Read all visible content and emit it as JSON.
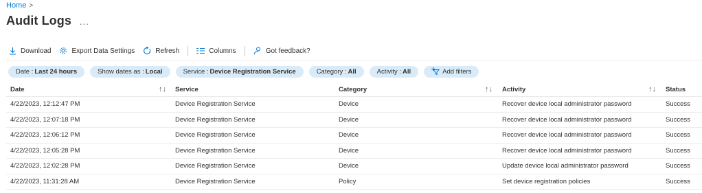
{
  "breadcrumb": {
    "home": "Home",
    "separator": ">"
  },
  "page": {
    "title": "Audit Logs",
    "more": "..."
  },
  "toolbar": {
    "download": "Download",
    "export": "Export Data Settings",
    "refresh": "Refresh",
    "columns": "Columns",
    "feedback": "Got feedback?"
  },
  "filters": [
    {
      "label": "Date : ",
      "value": "Last 24 hours"
    },
    {
      "label": "Show dates as : ",
      "value": "Local"
    },
    {
      "label": "Service : ",
      "value": "Device Registration Service"
    },
    {
      "label": "Category : ",
      "value": "All"
    },
    {
      "label": "Activity : ",
      "value": "All"
    }
  ],
  "add_filters": "Add filters",
  "table": {
    "headers": {
      "date": "Date",
      "service": "Service",
      "category": "Category",
      "activity": "Activity",
      "status": "Status"
    },
    "sort_glyph": "↑↓",
    "rows": [
      {
        "date": "4/22/2023, 12:12:47 PM",
        "service": "Device Registration Service",
        "category": "Device",
        "activity": "Recover device local administrator password",
        "status": "Success"
      },
      {
        "date": "4/22/2023, 12:07:18 PM",
        "service": "Device Registration Service",
        "category": "Device",
        "activity": "Recover device local administrator password",
        "status": "Success"
      },
      {
        "date": "4/22/2023, 12:06:12 PM",
        "service": "Device Registration Service",
        "category": "Device",
        "activity": "Recover device local administrator password",
        "status": "Success"
      },
      {
        "date": "4/22/2023, 12:05:28 PM",
        "service": "Device Registration Service",
        "category": "Device",
        "activity": "Recover device local administrator password",
        "status": "Success"
      },
      {
        "date": "4/22/2023, 12:02:28 PM",
        "service": "Device Registration Service",
        "category": "Device",
        "activity": "Update device local administrator password",
        "status": "Success"
      },
      {
        "date": "4/22/2023, 11:31:28 AM",
        "service": "Device Registration Service",
        "category": "Policy",
        "activity": "Set device registration policies",
        "status": "Success"
      }
    ]
  },
  "colors": {
    "accent": "#0078d4",
    "pill_bg": "#d9ebf8",
    "text": "#323130"
  },
  "icons": [
    "download-icon",
    "gear-icon",
    "refresh-icon",
    "columns-icon",
    "feedback-icon",
    "add-filter-icon",
    "sort-icon",
    "more-icon"
  ]
}
